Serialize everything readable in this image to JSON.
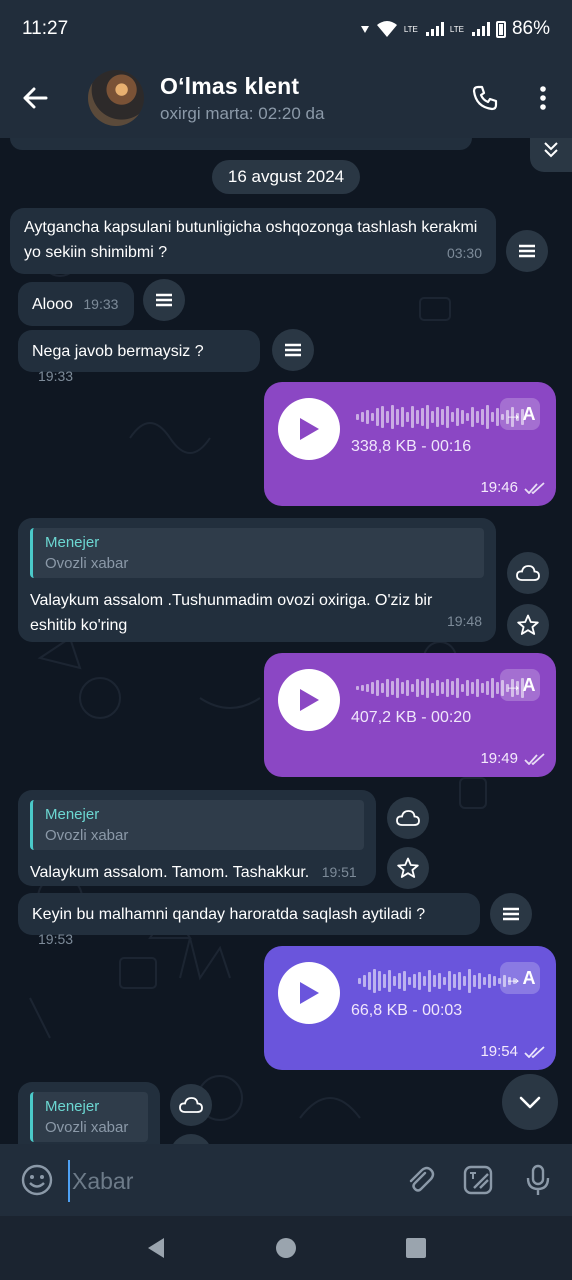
{
  "status": {
    "time": "11:27",
    "battery": "86%",
    "lte1": "LTE",
    "lte2": "LTE"
  },
  "header": {
    "name": "O‘lmas klent",
    "last_seen": "oxirgi marta: 02:20 da"
  },
  "date_chip": "16 avgust 2024",
  "messages": {
    "m1": {
      "text": "Aytgancha kapsulani butunligicha oshqozonga tashlash kerakmi yo sekiin shimibmi ?",
      "time": "03:30"
    },
    "m2": {
      "text": "Alooo",
      "time": "19:33"
    },
    "m3": {
      "text": "Nega javob bermaysiz ?",
      "time": "19:33"
    },
    "v1": {
      "meta": "338,8 KB - 00:16",
      "time": "19:46",
      "translate": "→A"
    },
    "m4": {
      "reply_name": "Menejer",
      "reply_text": "Ovozli xabar",
      "text": "Valaykum assalom .Tushunmadim ovozi oxiriga. O'ziz bir eshitib ko'ring",
      "time": "19:48"
    },
    "v2": {
      "meta": "407,2 KB - 00:20",
      "time": "19:49",
      "translate": "→A"
    },
    "m5": {
      "reply_name": "Menejer",
      "reply_text": "Ovozli xabar",
      "text": "Valaykum assalom. Tamom. Tashakkur.",
      "time": "19:51"
    },
    "m6": {
      "text": "Keyin bu malhamni qanday haroratda saqlash aytiladi ?",
      "time": "19:53"
    },
    "v3": {
      "meta": "66,8 KB - 00:03",
      "time": "19:54",
      "translate": "→A"
    },
    "m7": {
      "reply_name": "Menejer",
      "reply_text": "Ovozli xabar"
    }
  },
  "input": {
    "placeholder": "Xabar"
  },
  "colors": {
    "voice_purple": "#8b47c4",
    "voice_blue": "#6a55dc",
    "incoming": "#222f3d",
    "accent": "#4bc9c9"
  }
}
